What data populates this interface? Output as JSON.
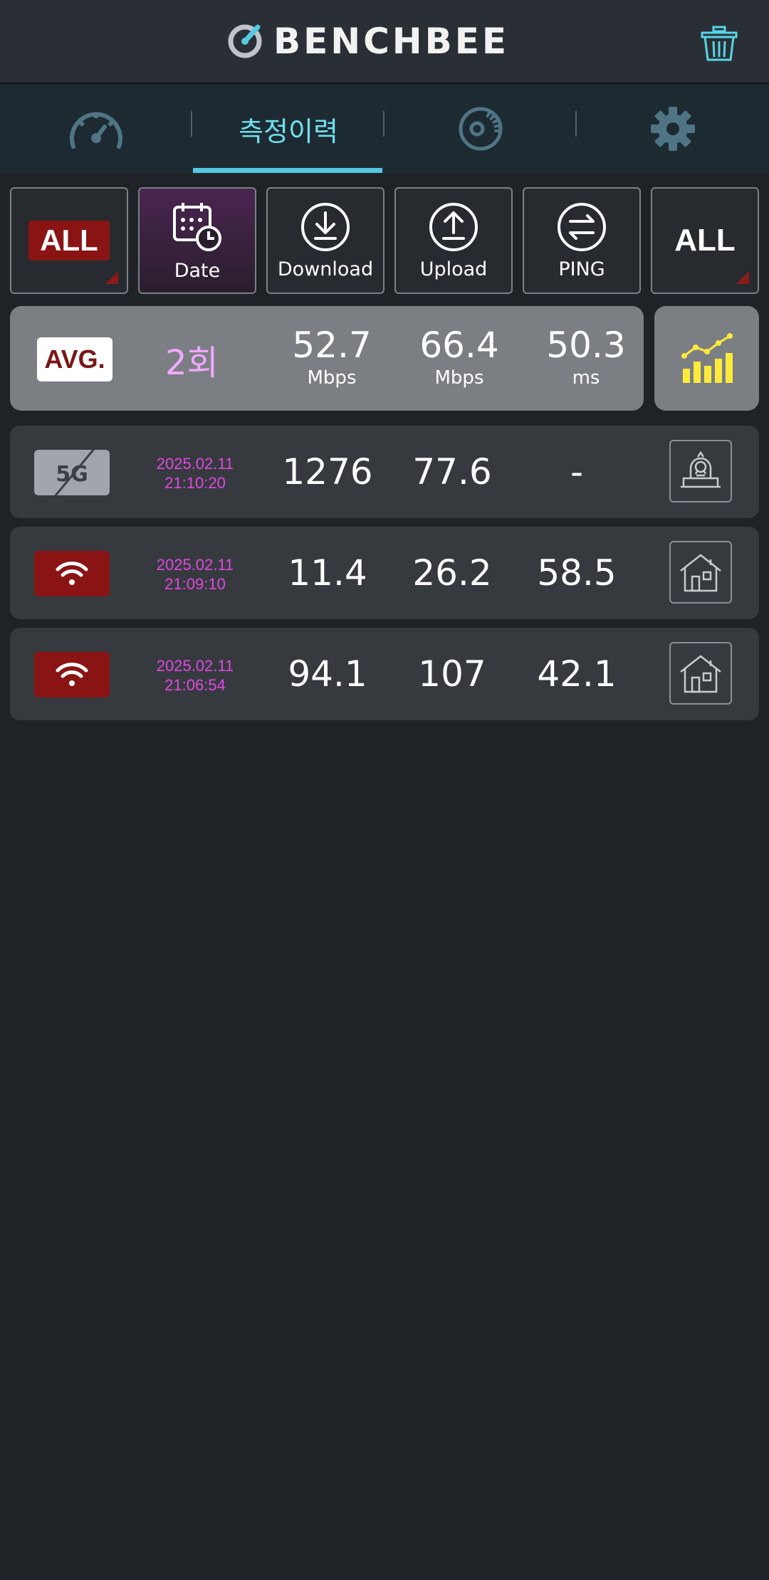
{
  "header": {
    "app_name": "BENCHBEE",
    "icons": {
      "logo": "benchbee-gauge-logo",
      "delete": "trash-icon"
    }
  },
  "tabs": [
    {
      "name": "speed-test",
      "icon": "speedometer-icon",
      "label": ""
    },
    {
      "name": "history",
      "icon": "",
      "label": "측정이력",
      "active": true
    },
    {
      "name": "analysis",
      "icon": "disc-pie-icon",
      "label": ""
    },
    {
      "name": "settings",
      "icon": "gear-icon",
      "label": ""
    }
  ],
  "filters": {
    "network_filter": "ALL",
    "date_label": "Date",
    "download_label": "Download",
    "upload_label": "Upload",
    "ping_label": "PING",
    "location_filter": "ALL"
  },
  "average": {
    "badge": "AVG.",
    "count": "2회",
    "download": "52.7",
    "download_unit": "Mbps",
    "upload": "66.4",
    "upload_unit": "Mbps",
    "ping": "50.3",
    "ping_unit": "ms"
  },
  "results": [
    {
      "network": "5G",
      "network_icon": "5g-disabled-icon",
      "date": "2025.02.11",
      "time": "21:10:20",
      "download": "1276",
      "upload": "77.6",
      "ping": "-",
      "place_icon": "transport-station-icon"
    },
    {
      "network": "WiFi",
      "network_icon": "wifi-icon",
      "date": "2025.02.11",
      "time": "21:09:10",
      "download": "11.4",
      "upload": "26.2",
      "ping": "58.5",
      "place_icon": "home-icon"
    },
    {
      "network": "WiFi",
      "network_icon": "wifi-icon",
      "date": "2025.02.11",
      "time": "21:06:54",
      "download": "94.1",
      "upload": "107",
      "ping": "42.1",
      "place_icon": "home-icon"
    }
  ],
  "colors": {
    "background": "#1f2328",
    "accent": "#56c8e0",
    "count_pink": "#f0a8ff",
    "date_magenta": "#e048e0",
    "badge_red": "#8a1414",
    "graph_yellow": "#ffea3a"
  }
}
